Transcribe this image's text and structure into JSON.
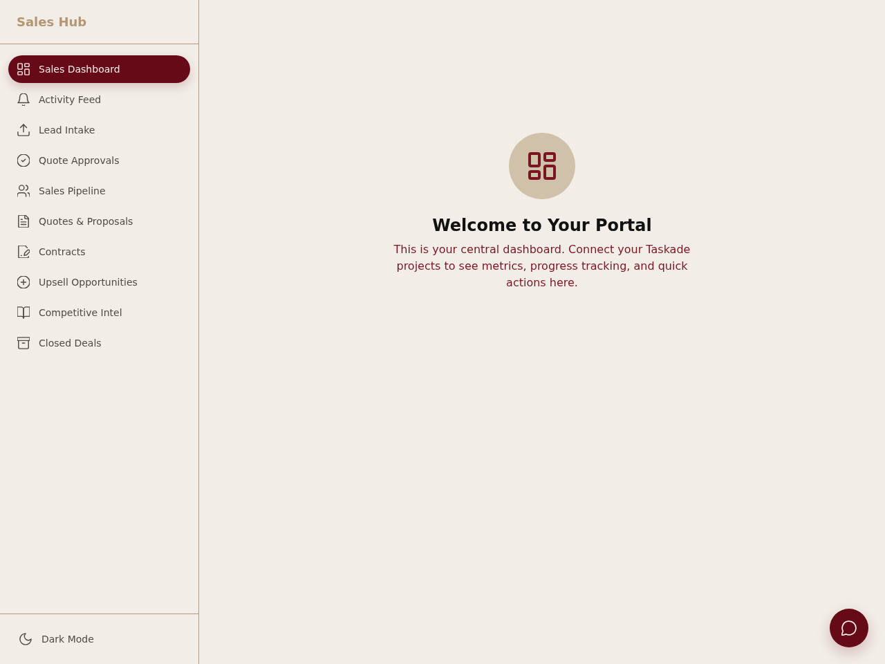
{
  "sidebar": {
    "title": "Sales Hub",
    "items": [
      {
        "label": "Sales Dashboard",
        "selected": true
      },
      {
        "label": "Activity Feed",
        "selected": false
      },
      {
        "label": "Lead Intake",
        "selected": false
      },
      {
        "label": "Quote Approvals",
        "selected": false
      },
      {
        "label": "Sales Pipeline",
        "selected": false
      },
      {
        "label": "Quotes & Proposals",
        "selected": false
      },
      {
        "label": "Contracts",
        "selected": false
      },
      {
        "label": "Upsell Opportunities",
        "selected": false
      },
      {
        "label": "Competitive Intel",
        "selected": false
      },
      {
        "label": "Closed Deals",
        "selected": false
      }
    ],
    "footer": {
      "label": "Dark Mode"
    }
  },
  "main": {
    "heading": "Welcome to Your Portal",
    "text": "This is your central dashboard. Connect your Taskade projects to see metrics, progress tracking, and quick actions here."
  }
}
